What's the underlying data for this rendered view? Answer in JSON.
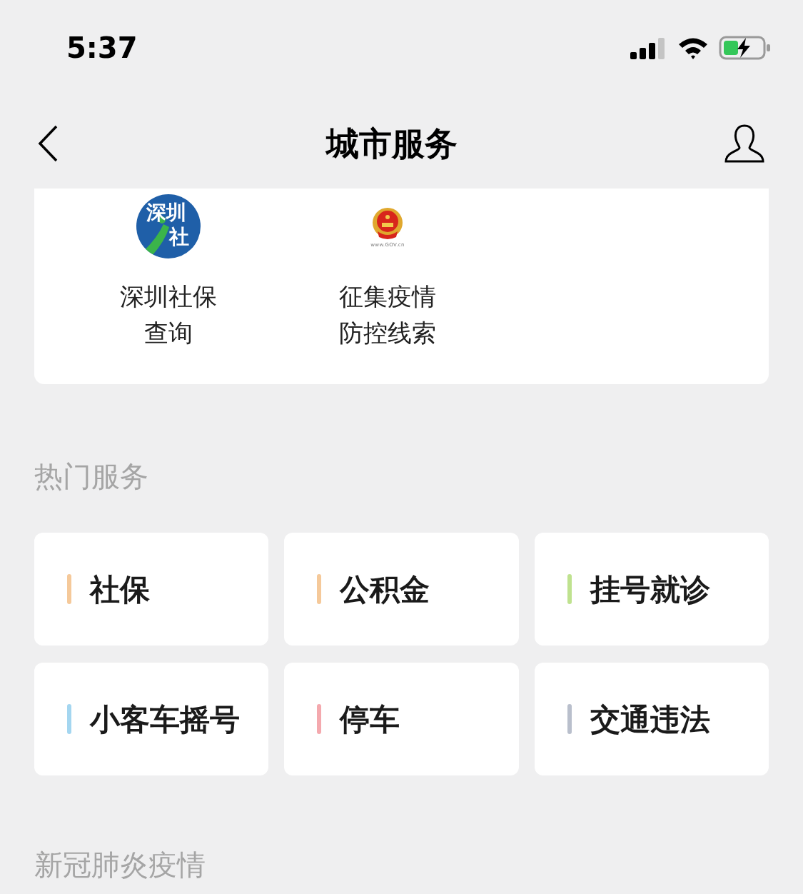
{
  "status_bar": {
    "time": "5:37"
  },
  "nav": {
    "title": "城市服务"
  },
  "services": [
    {
      "kind": "shenzhen",
      "logo_lines": [
        "深圳",
        "社"
      ],
      "label_lines": [
        "深圳社保",
        "查询"
      ]
    },
    {
      "kind": "gov",
      "logo_caption": "www.GOV.cn",
      "label_lines": [
        "征集疫情",
        "防控线索"
      ]
    }
  ],
  "hot_section": {
    "title": "热门服务",
    "tiles": [
      {
        "label": "社保",
        "color": "#f5c99a"
      },
      {
        "label": "公积金",
        "color": "#f5c99a"
      },
      {
        "label": "挂号就诊",
        "color": "#bfe28f"
      },
      {
        "label": "小客车摇号",
        "color": "#a4d6f0"
      },
      {
        "label": "停车",
        "color": "#f4a9ae"
      },
      {
        "label": "交通违法",
        "color": "#b9bfcc"
      }
    ]
  },
  "next_section": {
    "title": "新冠肺炎疫情"
  }
}
